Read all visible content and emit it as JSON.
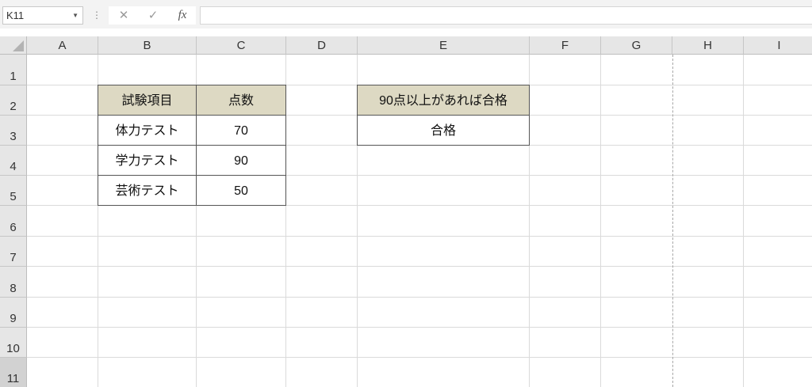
{
  "formula_bar": {
    "name_box": "K11",
    "cancel_icon": "✕",
    "enter_icon": "✓",
    "function_label": "fx",
    "formula": ""
  },
  "columns": [
    "A",
    "B",
    "C",
    "D",
    "E",
    "F",
    "G",
    "H",
    "I"
  ],
  "rows": [
    "1",
    "2",
    "3",
    "4",
    "5",
    "6",
    "7",
    "8",
    "9",
    "10",
    "11"
  ],
  "table": {
    "headers": [
      "試験項目",
      "点数"
    ],
    "rows": [
      [
        "体力テスト",
        "70"
      ],
      [
        "学力テスト",
        "90"
      ],
      [
        "芸術テスト",
        "50"
      ]
    ]
  },
  "result": {
    "header": "90点以上があれば合格",
    "value": "合格"
  },
  "colors": {
    "header_fill": "#ddd9c3",
    "gridline": "#dadada",
    "header_bg": "#e6e6e6"
  }
}
